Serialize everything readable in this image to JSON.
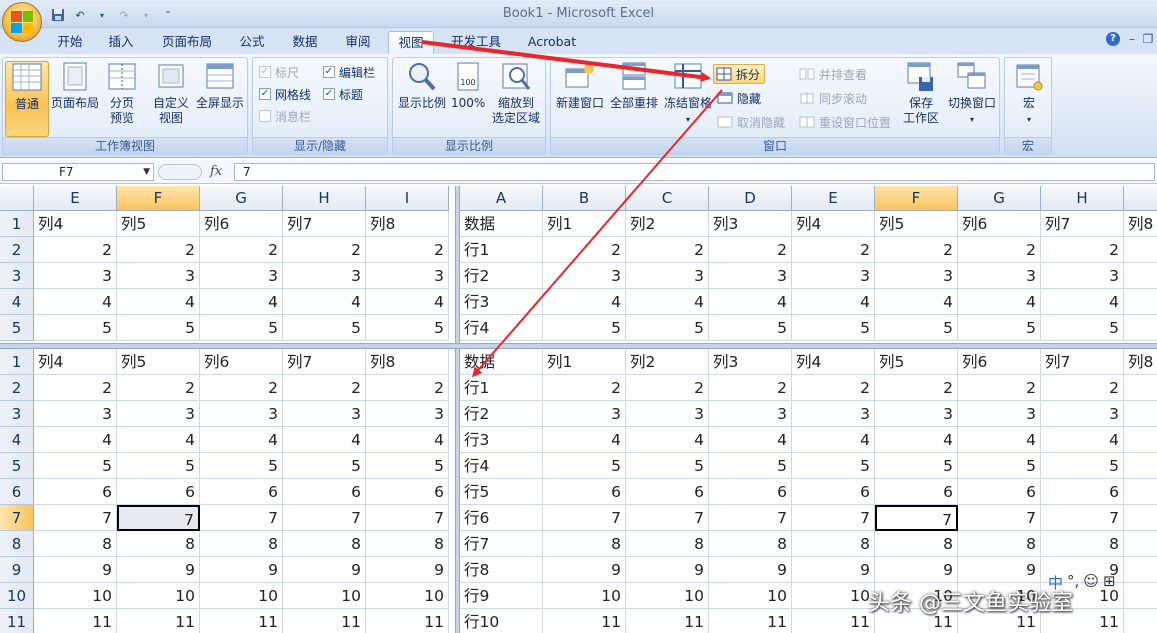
{
  "app": {
    "title": "Book1 - Microsoft Excel"
  },
  "tabs": [
    {
      "label": "开始"
    },
    {
      "label": "插入"
    },
    {
      "label": "页面布局"
    },
    {
      "label": "公式"
    },
    {
      "label": "数据"
    },
    {
      "label": "审阅"
    },
    {
      "label": "视图"
    },
    {
      "label": "开发工具"
    },
    {
      "label": "Acrobat"
    }
  ],
  "active_tab": "视图",
  "ribbon": {
    "workbook_views": {
      "label": "工作簿视图",
      "normal": "普通",
      "page_layout": "页面布局",
      "page_break": [
        "分页",
        "预览"
      ],
      "custom": [
        "自定义",
        "视图"
      ],
      "full_screen": "全屏显示"
    },
    "show_hide": {
      "label": "显示/隐藏",
      "ruler": "标尺",
      "edit_bar": "编辑栏",
      "gridlines": "网格线",
      "headings": "标题",
      "message_bar": "消息栏"
    },
    "zoom": {
      "label": "显示比例",
      "zoom": "显示比例",
      "hundred": "100%",
      "to_selection": [
        "缩放到",
        "选定区域"
      ]
    },
    "window": {
      "label": "窗口",
      "new_window": "新建窗口",
      "arrange_all": "全部重排",
      "freeze": "冻结窗格",
      "split": "拆分",
      "hide": "隐藏",
      "unhide": "取消隐藏",
      "side_by_side": "并排查看",
      "sync_scroll": "同步滚动",
      "reset_position": "重设窗口位置",
      "save_workspace": [
        "保存",
        "工作区"
      ],
      "switch_window": "切换窗口"
    },
    "macros": {
      "label": "宏",
      "macros": "宏"
    }
  },
  "formula_bar": {
    "name_box": "F7",
    "fx": "fx",
    "value": "7"
  },
  "sheet": {
    "left_columns": [
      "E",
      "F",
      "G",
      "H",
      "I"
    ],
    "right_columns": [
      "A",
      "B",
      "C",
      "D",
      "E",
      "F",
      "G",
      "H",
      ""
    ],
    "selected_column": "F",
    "selected_row": "7",
    "top_rows": [
      "1",
      "2",
      "3",
      "4",
      "5"
    ],
    "bottom_rows": [
      "1",
      "2",
      "3",
      "4",
      "5",
      "6",
      "7",
      "8",
      "9",
      "10",
      "11"
    ],
    "col_headers": [
      "数据",
      "列1",
      "列2",
      "列3",
      "列4",
      "列5",
      "列6",
      "列7",
      "列8"
    ],
    "row_labels": [
      "行1",
      "行2",
      "行3",
      "行4",
      "行5",
      "行6",
      "行7",
      "行8",
      "行9",
      "行10"
    ],
    "values": [
      "2",
      "3",
      "4",
      "5",
      "6",
      "7",
      "8",
      "9",
      "10",
      "11"
    ]
  },
  "watermark": {
    "text": "头条 @三文鱼实验室",
    "ime": [
      "中",
      "°,",
      "☺",
      "⊞"
    ]
  },
  "colors": {
    "accent": "#f9c35c",
    "arrow": "#e8262b",
    "tab_text": "#15306a"
  }
}
